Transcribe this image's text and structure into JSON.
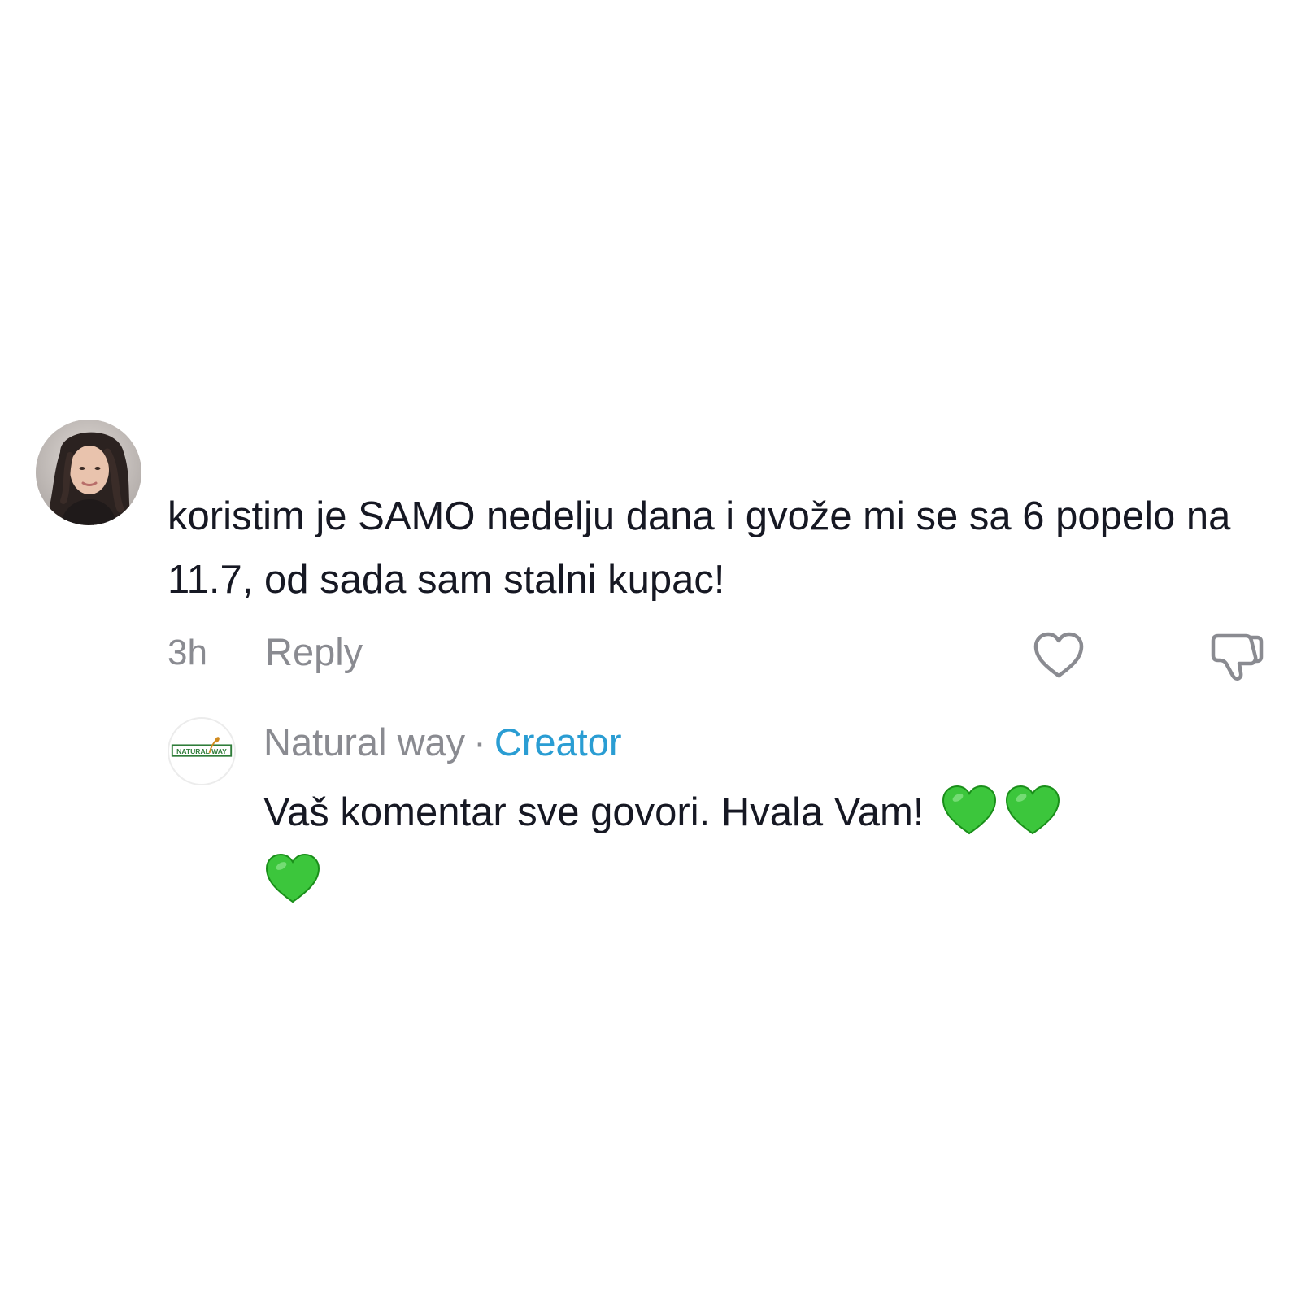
{
  "comment": {
    "text": "koristim je SAMO nedelju dana i gvože mi se sa 6 popelo na 11.7, od sada sam stalni kupac!",
    "time": "3h",
    "reply_label": "Reply",
    "avatar_icon": "user-avatar-photo",
    "like_icon": "heart-outline-icon",
    "dislike_icon": "thumbs-down-outline-icon"
  },
  "creator_reply": {
    "name": "Natural way",
    "separator": "·",
    "badge": "Creator",
    "text": "Vaš komentar sve govori. Hvala Vam!",
    "emoji_count": 3,
    "emoji": "green-heart-emoji",
    "logo_text": "NATURAL WAY"
  },
  "colors": {
    "background": "#ffffff",
    "primary_text": "#161823",
    "secondary_text": "#8a8b91",
    "creator_badge": "#2a9dd3",
    "emoji_green": "#3cc63c"
  }
}
